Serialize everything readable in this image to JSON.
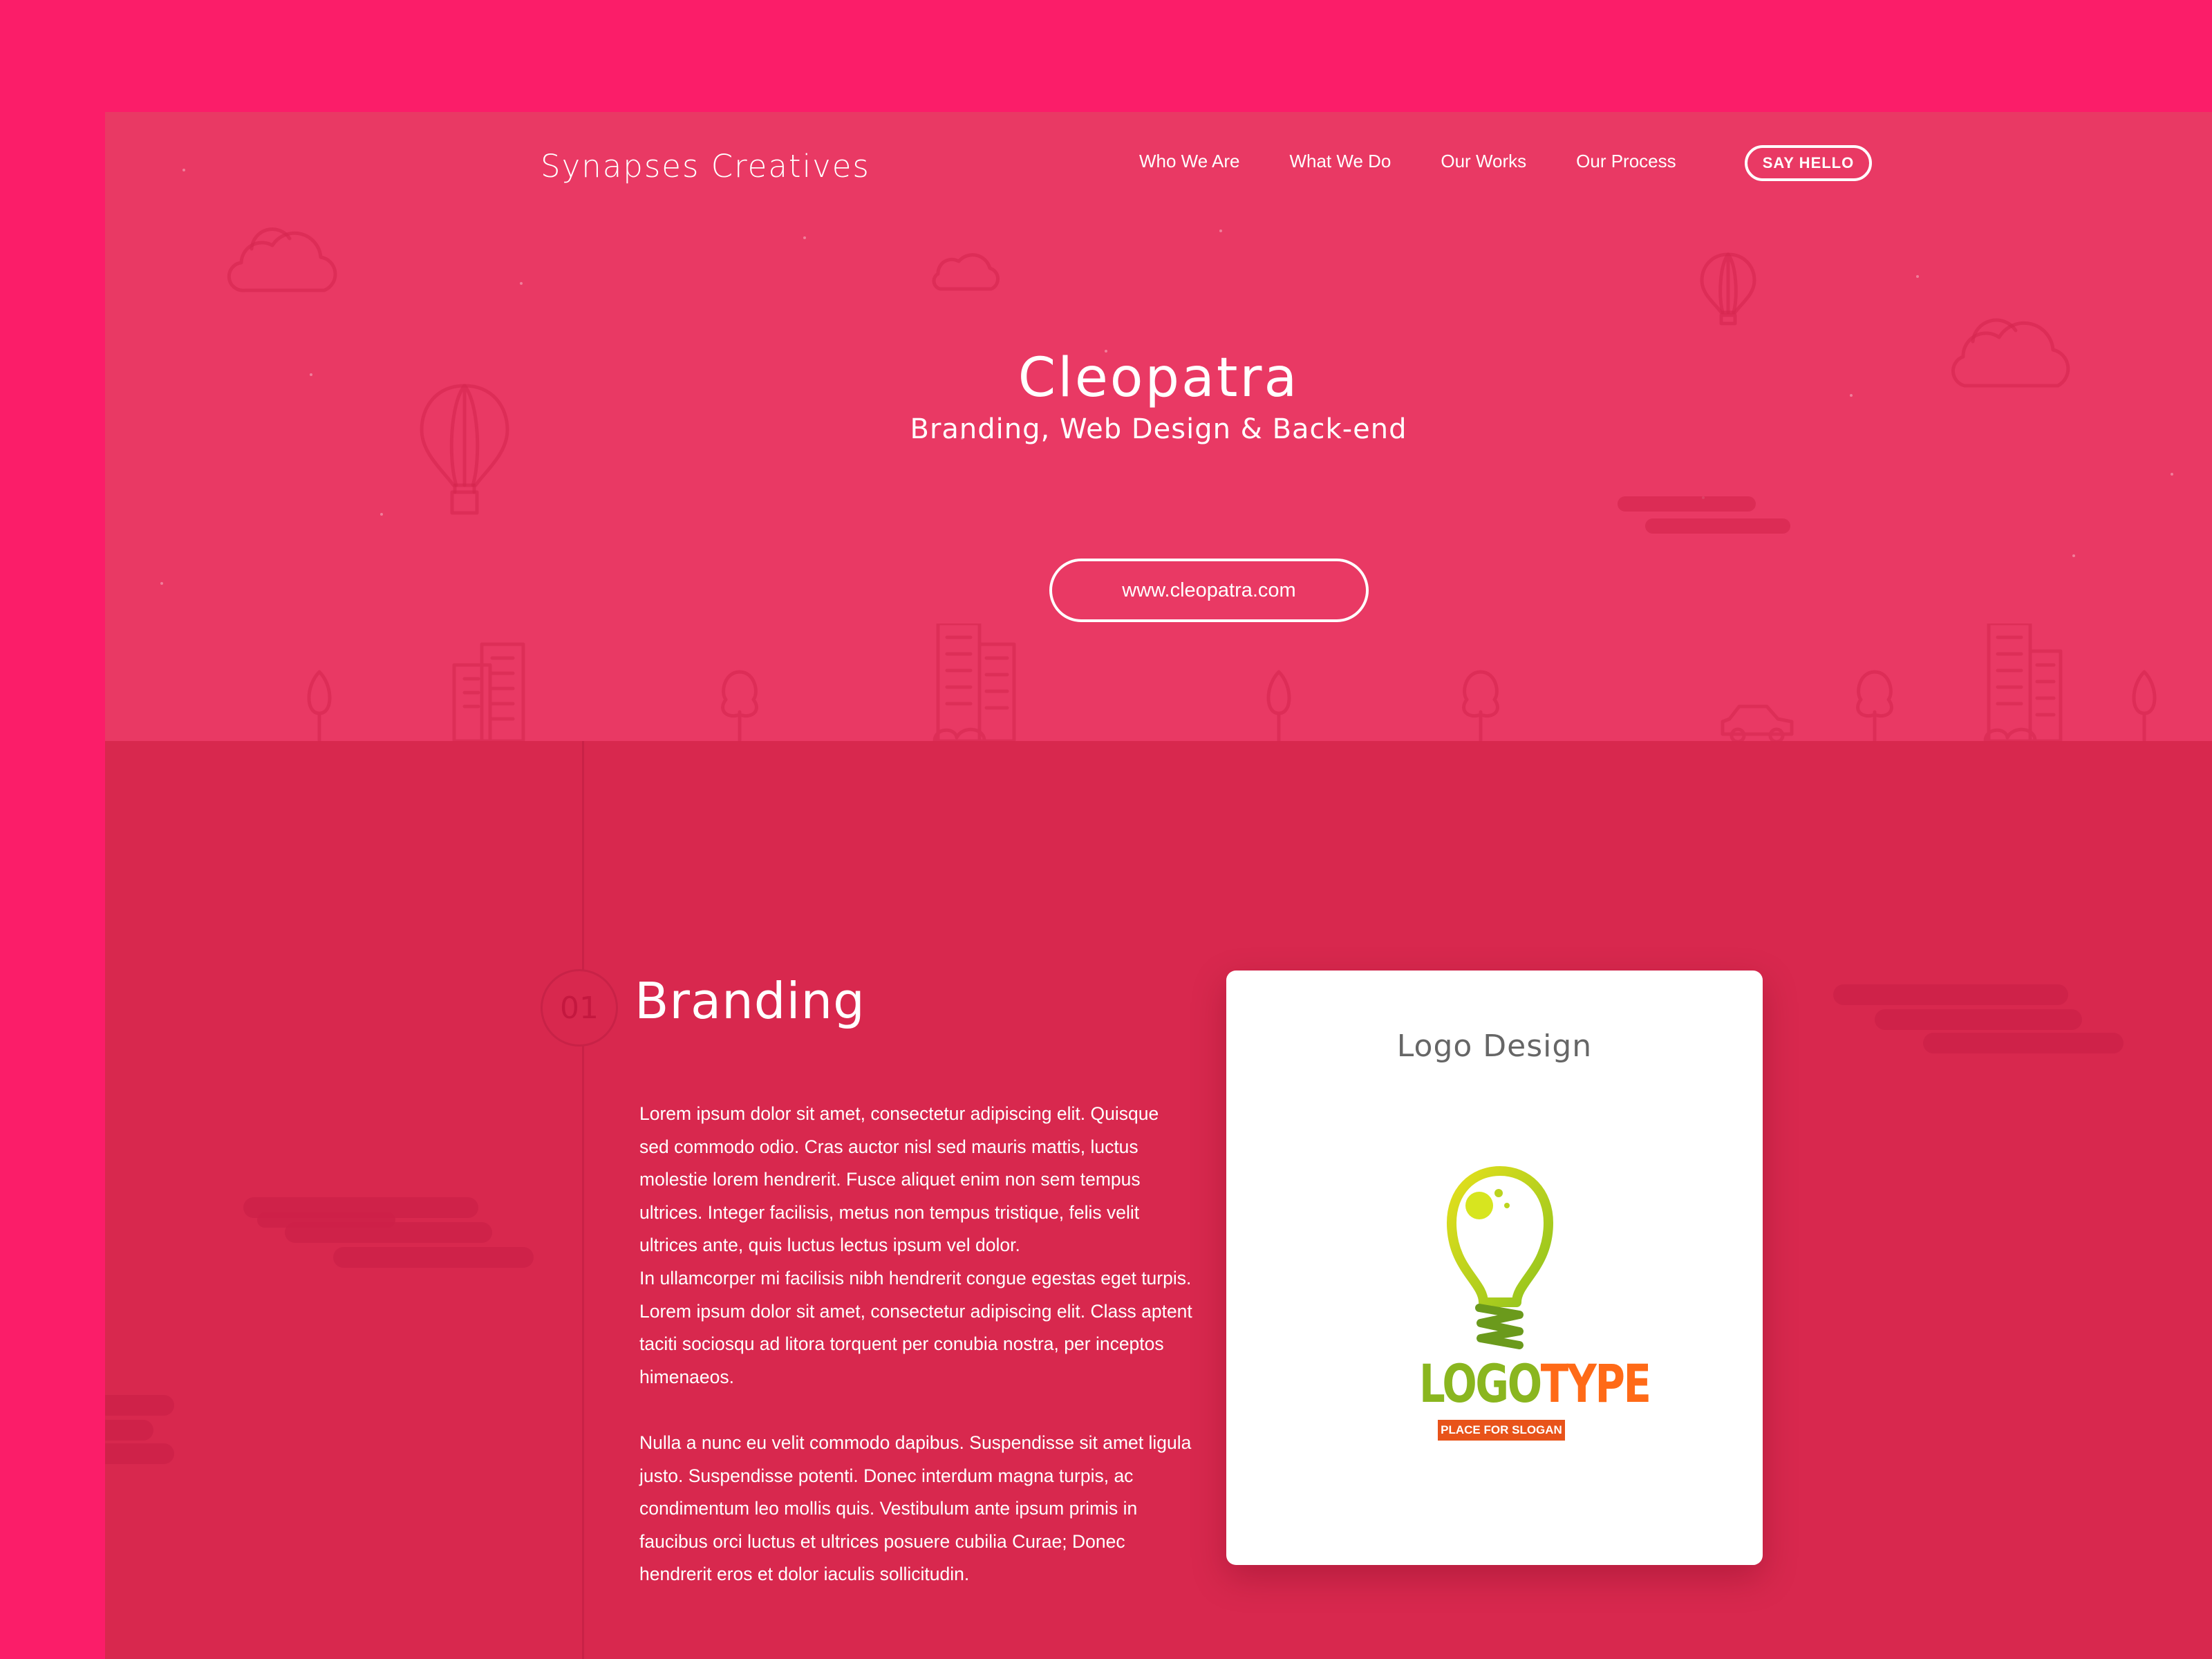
{
  "site": {
    "brand": "Synapses Creatives",
    "nav": [
      "Who We Are",
      "What We Do",
      "Our Works",
      "Our Process"
    ],
    "cta": "SAY HELLO"
  },
  "hero": {
    "title": "Cleopatra",
    "subtitle": "Branding, Web Design & Back-end",
    "url": "www.cleopatra.com"
  },
  "section": {
    "number": "01",
    "title": "Branding",
    "paragraphs": [
      "Lorem ipsum dolor sit amet, consectetur adipiscing elit. Quisque sed commodo odio. Cras auctor nisl sed mauris mattis, luctus molestie lorem hendrerit. Fusce aliquet enim non sem tempus ultrices. Integer facilisis, metus non tempus tristique, felis velit ultrices ante, quis luctus lectus ipsum vel dolor.",
      "In ullamcorper mi facilisis nibh hendrerit congue egestas eget turpis. Lorem ipsum dolor sit amet, consectetur adipiscing elit. Class aptent taciti sociosqu ad litora torquent per conubia nostra, per inceptos himenaeos.",
      "Nulla a nunc eu velit commodo dapibus. Suspendisse sit amet ligula justo. Suspendisse potenti. Donec interdum magna turpis, ac condimentum leo mollis quis. Vestibulum ante ipsum primis in faucibus orci luctus et ultrices posuere cubilia Curae; Donec hendrerit eros et dolor iaculis sollicitudin."
    ]
  },
  "slider": {
    "card_title": "Logo Design",
    "logo": {
      "part1": "LOGO",
      "part2": "TYPE",
      "slogan": "PLACE FOR SLOGAN"
    },
    "prev_icon": "arrow-left-icon",
    "next_icon": "arrow-right-icon"
  },
  "colors": {
    "page_bg": "#fb1d69",
    "hero_bg": "#e93964",
    "content_bg": "#d8284e",
    "text": "#ffffff",
    "logo_green": "#8ab61f",
    "logo_orange": "#ff6a17"
  }
}
